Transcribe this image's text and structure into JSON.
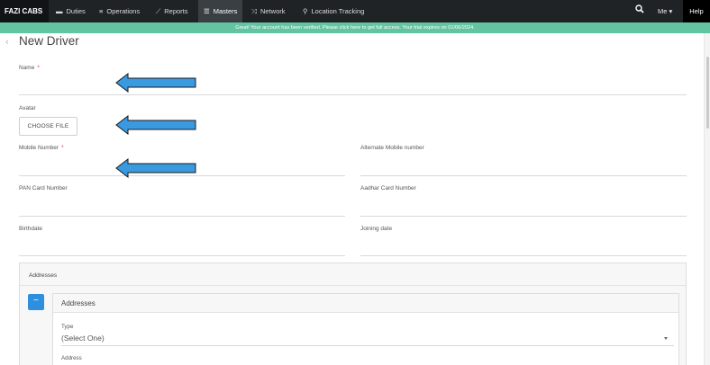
{
  "nav": {
    "brand": "FAZI CABS",
    "items": [
      {
        "label": "Duties",
        "icon": "list-dash-icon",
        "glyph": "▬"
      },
      {
        "label": "Operations",
        "icon": "menu-lines-icon",
        "glyph": "≡"
      },
      {
        "label": "Reports",
        "icon": "chart-line-icon",
        "glyph": "⟋"
      },
      {
        "label": "Masters",
        "icon": "database-icon",
        "glyph": "☰"
      },
      {
        "label": "Network",
        "icon": "shuffle-icon",
        "glyph": "⤨"
      },
      {
        "label": "Location Tracking",
        "icon": "map-pin-icon",
        "glyph": "⚲"
      }
    ],
    "active": "Masters",
    "user": "Me ▾",
    "help": "Help"
  },
  "banner": {
    "text": "Great! Your account has been verified. Please click here to get full access. Your trial expires on 01/06/2024."
  },
  "page": {
    "back": "‹",
    "title": "New Driver"
  },
  "form": {
    "name_label": "Name",
    "required_mark": "*",
    "avatar_label": "Avatar",
    "choose_file": "CHOOSE FILE",
    "mobile_label": "Mobile Number",
    "alt_mobile_label": "Alternate Mobile number",
    "pan_label": "PAN Card Number",
    "aadhar_label": "Aadhar Card Number",
    "birthdate_label": "Birthdate",
    "joining_label": "Joining date"
  },
  "addresses": {
    "panel_title": "Addresses",
    "remove_label": "−",
    "inner_title": "Addresses",
    "type_label": "Type",
    "type_value": "(Select One)",
    "address_label": "Address"
  },
  "colors": {
    "nav_bg": "#1f2326",
    "banner_bg": "#62c4a0",
    "accent": "#2f8fdf",
    "arrow_fill": "#3a9ae0",
    "required": "#e53935"
  }
}
